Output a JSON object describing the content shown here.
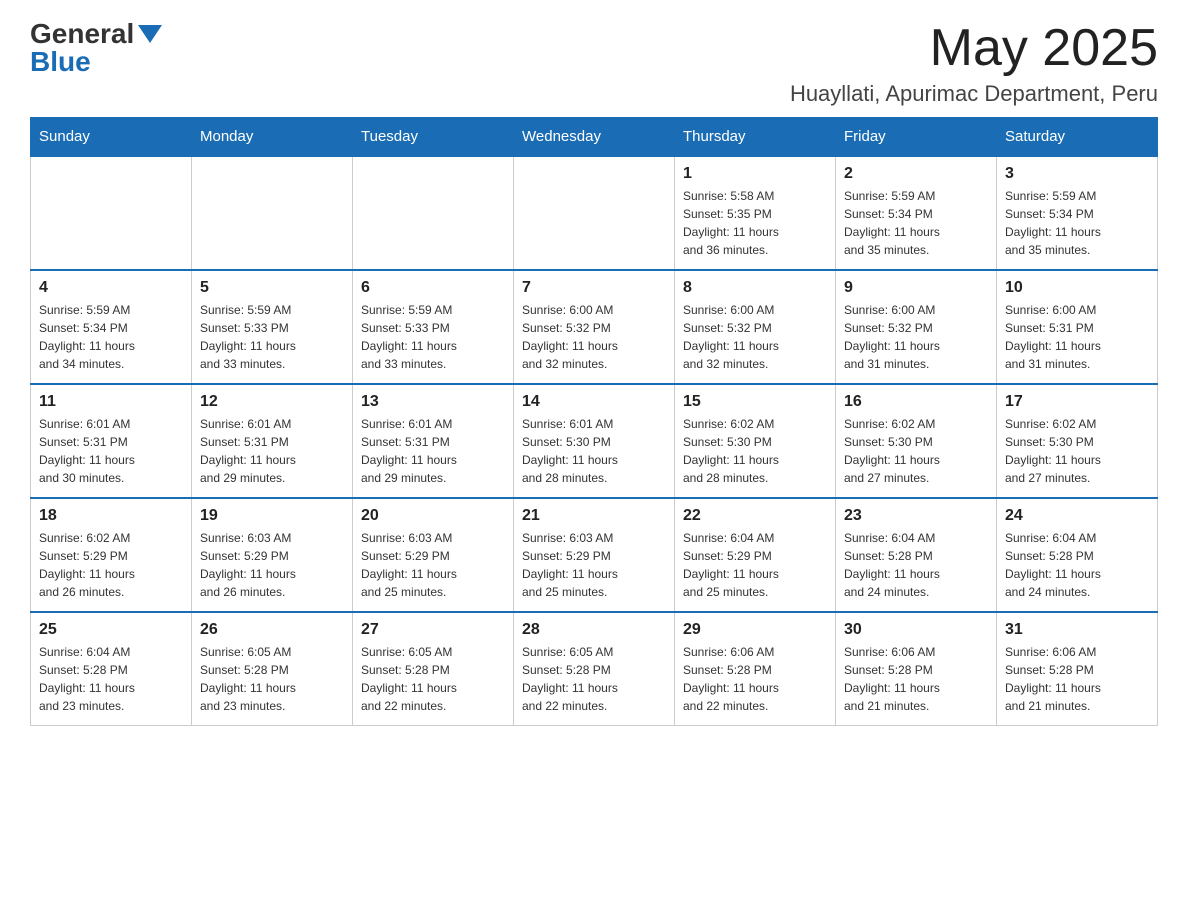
{
  "logo": {
    "general": "General",
    "blue": "Blue"
  },
  "header": {
    "month": "May 2025",
    "location": "Huayllati, Apurimac Department, Peru"
  },
  "weekdays": [
    "Sunday",
    "Monday",
    "Tuesday",
    "Wednesday",
    "Thursday",
    "Friday",
    "Saturday"
  ],
  "weeks": [
    [
      {
        "day": "",
        "info": ""
      },
      {
        "day": "",
        "info": ""
      },
      {
        "day": "",
        "info": ""
      },
      {
        "day": "",
        "info": ""
      },
      {
        "day": "1",
        "info": "Sunrise: 5:58 AM\nSunset: 5:35 PM\nDaylight: 11 hours\nand 36 minutes."
      },
      {
        "day": "2",
        "info": "Sunrise: 5:59 AM\nSunset: 5:34 PM\nDaylight: 11 hours\nand 35 minutes."
      },
      {
        "day": "3",
        "info": "Sunrise: 5:59 AM\nSunset: 5:34 PM\nDaylight: 11 hours\nand 35 minutes."
      }
    ],
    [
      {
        "day": "4",
        "info": "Sunrise: 5:59 AM\nSunset: 5:34 PM\nDaylight: 11 hours\nand 34 minutes."
      },
      {
        "day": "5",
        "info": "Sunrise: 5:59 AM\nSunset: 5:33 PM\nDaylight: 11 hours\nand 33 minutes."
      },
      {
        "day": "6",
        "info": "Sunrise: 5:59 AM\nSunset: 5:33 PM\nDaylight: 11 hours\nand 33 minutes."
      },
      {
        "day": "7",
        "info": "Sunrise: 6:00 AM\nSunset: 5:32 PM\nDaylight: 11 hours\nand 32 minutes."
      },
      {
        "day": "8",
        "info": "Sunrise: 6:00 AM\nSunset: 5:32 PM\nDaylight: 11 hours\nand 32 minutes."
      },
      {
        "day": "9",
        "info": "Sunrise: 6:00 AM\nSunset: 5:32 PM\nDaylight: 11 hours\nand 31 minutes."
      },
      {
        "day": "10",
        "info": "Sunrise: 6:00 AM\nSunset: 5:31 PM\nDaylight: 11 hours\nand 31 minutes."
      }
    ],
    [
      {
        "day": "11",
        "info": "Sunrise: 6:01 AM\nSunset: 5:31 PM\nDaylight: 11 hours\nand 30 minutes."
      },
      {
        "day": "12",
        "info": "Sunrise: 6:01 AM\nSunset: 5:31 PM\nDaylight: 11 hours\nand 29 minutes."
      },
      {
        "day": "13",
        "info": "Sunrise: 6:01 AM\nSunset: 5:31 PM\nDaylight: 11 hours\nand 29 minutes."
      },
      {
        "day": "14",
        "info": "Sunrise: 6:01 AM\nSunset: 5:30 PM\nDaylight: 11 hours\nand 28 minutes."
      },
      {
        "day": "15",
        "info": "Sunrise: 6:02 AM\nSunset: 5:30 PM\nDaylight: 11 hours\nand 28 minutes."
      },
      {
        "day": "16",
        "info": "Sunrise: 6:02 AM\nSunset: 5:30 PM\nDaylight: 11 hours\nand 27 minutes."
      },
      {
        "day": "17",
        "info": "Sunrise: 6:02 AM\nSunset: 5:30 PM\nDaylight: 11 hours\nand 27 minutes."
      }
    ],
    [
      {
        "day": "18",
        "info": "Sunrise: 6:02 AM\nSunset: 5:29 PM\nDaylight: 11 hours\nand 26 minutes."
      },
      {
        "day": "19",
        "info": "Sunrise: 6:03 AM\nSunset: 5:29 PM\nDaylight: 11 hours\nand 26 minutes."
      },
      {
        "day": "20",
        "info": "Sunrise: 6:03 AM\nSunset: 5:29 PM\nDaylight: 11 hours\nand 25 minutes."
      },
      {
        "day": "21",
        "info": "Sunrise: 6:03 AM\nSunset: 5:29 PM\nDaylight: 11 hours\nand 25 minutes."
      },
      {
        "day": "22",
        "info": "Sunrise: 6:04 AM\nSunset: 5:29 PM\nDaylight: 11 hours\nand 25 minutes."
      },
      {
        "day": "23",
        "info": "Sunrise: 6:04 AM\nSunset: 5:28 PM\nDaylight: 11 hours\nand 24 minutes."
      },
      {
        "day": "24",
        "info": "Sunrise: 6:04 AM\nSunset: 5:28 PM\nDaylight: 11 hours\nand 24 minutes."
      }
    ],
    [
      {
        "day": "25",
        "info": "Sunrise: 6:04 AM\nSunset: 5:28 PM\nDaylight: 11 hours\nand 23 minutes."
      },
      {
        "day": "26",
        "info": "Sunrise: 6:05 AM\nSunset: 5:28 PM\nDaylight: 11 hours\nand 23 minutes."
      },
      {
        "day": "27",
        "info": "Sunrise: 6:05 AM\nSunset: 5:28 PM\nDaylight: 11 hours\nand 22 minutes."
      },
      {
        "day": "28",
        "info": "Sunrise: 6:05 AM\nSunset: 5:28 PM\nDaylight: 11 hours\nand 22 minutes."
      },
      {
        "day": "29",
        "info": "Sunrise: 6:06 AM\nSunset: 5:28 PM\nDaylight: 11 hours\nand 22 minutes."
      },
      {
        "day": "30",
        "info": "Sunrise: 6:06 AM\nSunset: 5:28 PM\nDaylight: 11 hours\nand 21 minutes."
      },
      {
        "day": "31",
        "info": "Sunrise: 6:06 AM\nSunset: 5:28 PM\nDaylight: 11 hours\nand 21 minutes."
      }
    ]
  ]
}
